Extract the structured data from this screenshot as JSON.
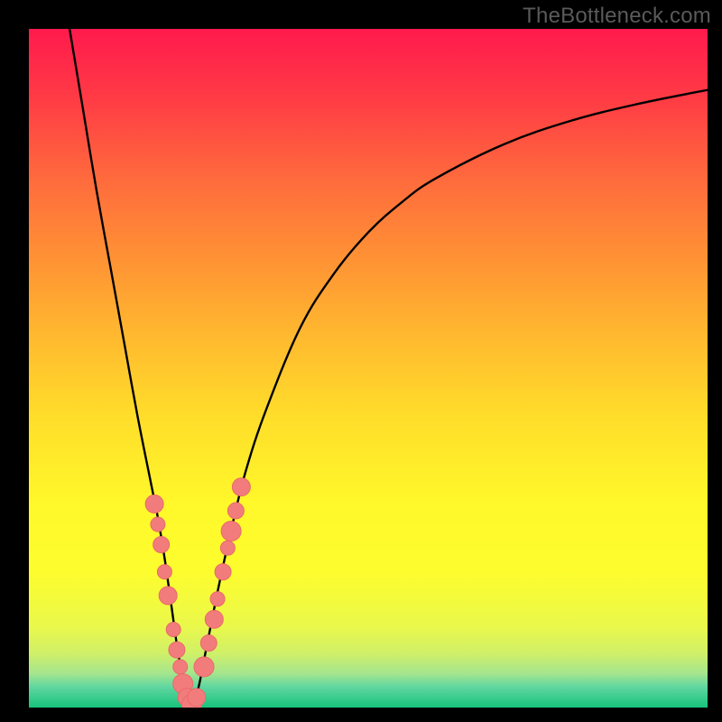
{
  "watermark": "TheBottleneck.com",
  "colors": {
    "curve": "#000000",
    "dots": "#f27c7c",
    "dots_stroke": "#e86a6a",
    "frame": "#000000"
  },
  "chart_data": {
    "type": "line",
    "title": "",
    "xlabel": "",
    "ylabel": "",
    "xlim": [
      0,
      100
    ],
    "ylim": [
      0,
      100
    ],
    "grid": false,
    "legend": false,
    "series": [
      {
        "name": "bottleneck-curve",
        "x": [
          6,
          8,
          10,
          12,
          14,
          16,
          18,
          19,
          20,
          21,
          22,
          23,
          24,
          25,
          26,
          28,
          30,
          32,
          35,
          40,
          45,
          50,
          55,
          60,
          70,
          80,
          90,
          100
        ],
        "values": [
          100,
          88,
          76,
          65,
          54,
          43,
          33,
          28,
          22,
          15,
          8,
          3,
          0,
          3,
          8,
          18,
          27,
          35,
          44,
          56,
          64,
          70,
          74.5,
          78,
          83,
          86.5,
          89,
          91
        ]
      }
    ],
    "marked_points": {
      "name": "marked-dots",
      "x": [
        18.5,
        19.0,
        19.5,
        20.0,
        20.5,
        21.3,
        21.8,
        22.3,
        22.7,
        23.3,
        24.0,
        24.7,
        25.8,
        26.5,
        27.3,
        27.8,
        28.6,
        29.3,
        29.8,
        30.5,
        31.3
      ],
      "values": [
        30.0,
        27.0,
        24.0,
        20.0,
        16.5,
        11.5,
        8.5,
        6.0,
        3.5,
        1.5,
        0.5,
        1.5,
        6.0,
        9.5,
        13.0,
        16.0,
        20.0,
        23.5,
        26.0,
        29.0,
        32.5
      ],
      "radius": [
        10,
        8,
        9,
        8,
        10,
        8,
        9,
        8,
        11,
        10,
        11,
        10,
        11,
        9,
        10,
        8,
        9,
        8,
        11,
        9,
        10
      ]
    }
  }
}
